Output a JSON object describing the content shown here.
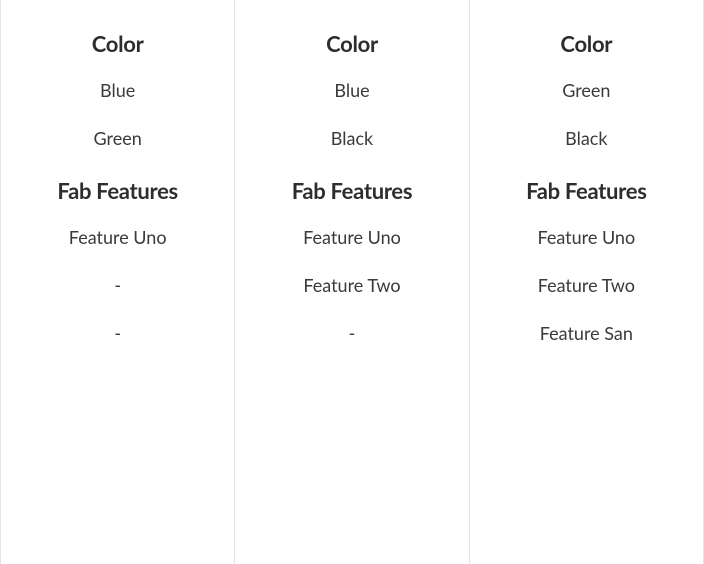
{
  "columns": [
    {
      "color_header": "Color",
      "color_values": [
        "Blue",
        "Green"
      ],
      "features_header": "Fab Features",
      "features_values": [
        "Feature Uno",
        "-",
        "-"
      ]
    },
    {
      "color_header": "Color",
      "color_values": [
        "Blue",
        "Black"
      ],
      "features_header": "Fab Features",
      "features_values": [
        "Feature Uno",
        "Feature Two",
        "-"
      ]
    },
    {
      "color_header": "Color",
      "color_values": [
        "Green",
        "Black"
      ],
      "features_header": "Fab Features",
      "features_values": [
        "Feature Uno",
        "Feature Two",
        "Feature San"
      ]
    }
  ]
}
